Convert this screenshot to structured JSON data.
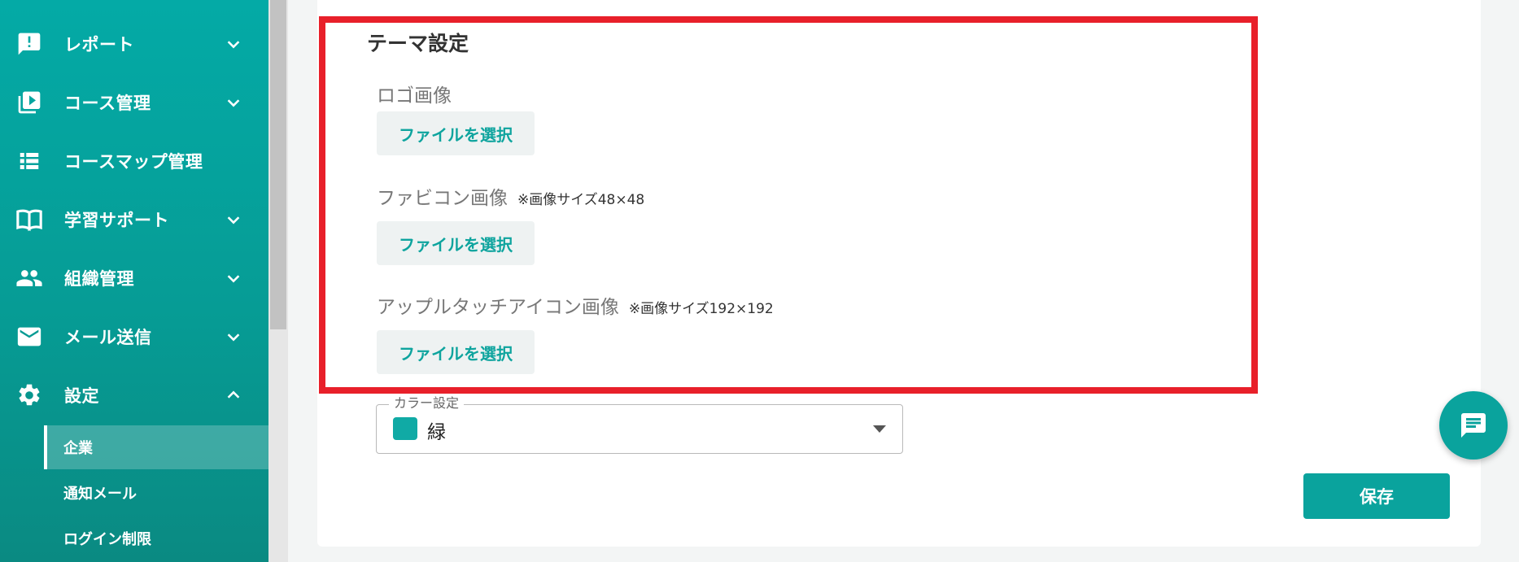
{
  "sidebar": {
    "items": [
      {
        "label": "レポート",
        "icon": "report-alert-icon",
        "expandable": true
      },
      {
        "label": "コース管理",
        "icon": "video-library-icon",
        "expandable": true
      },
      {
        "label": "コースマップ管理",
        "icon": "list-icon",
        "expandable": false
      },
      {
        "label": "学習サポート",
        "icon": "book-open-icon",
        "expandable": true
      },
      {
        "label": "組織管理",
        "icon": "people-icon",
        "expandable": true
      },
      {
        "label": "メール送信",
        "icon": "mail-icon",
        "expandable": true
      },
      {
        "label": "設定",
        "icon": "gear-icon",
        "expandable": true,
        "expanded": true
      }
    ],
    "settings_subitems": [
      {
        "label": "企業",
        "active": true
      },
      {
        "label": "通知メール",
        "active": false
      },
      {
        "label": "ログイン制限",
        "active": false
      }
    ]
  },
  "theme": {
    "title": "テーマ設定",
    "logo_label": "ロゴ画像",
    "favicon_label": "ファビコン画像",
    "favicon_note": "※画像サイズ48×48",
    "apple_label": "アップルタッチアイコン画像",
    "apple_note": "※画像サイズ192×192",
    "file_button_label": "ファイルを選択"
  },
  "color_setting": {
    "legend": "カラー設定",
    "value": "緑",
    "swatch_color": "#10aaa5"
  },
  "actions": {
    "save_label": "保存"
  },
  "colors": {
    "brand": "#0aa39d",
    "highlight": "#e8202a"
  }
}
